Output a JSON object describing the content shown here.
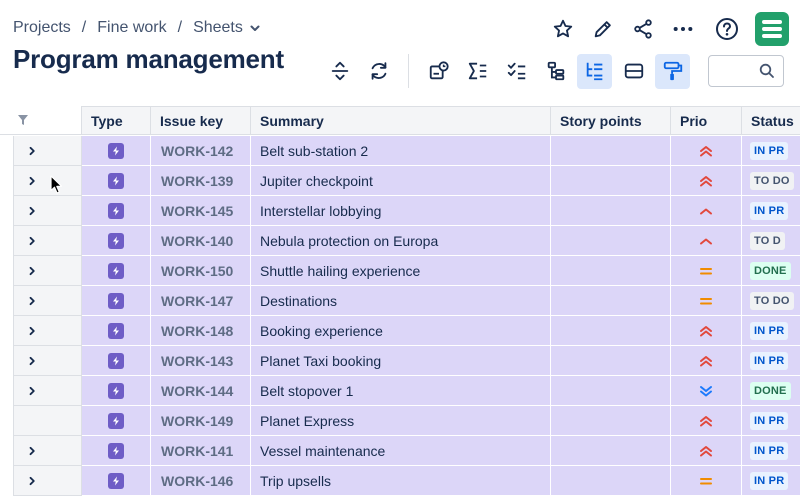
{
  "breadcrumb": {
    "items": [
      "Projects",
      "Fine work",
      "Sheets"
    ],
    "separator": "/"
  },
  "page": {
    "title": "Program management"
  },
  "search": {
    "placeholder": "",
    "value": ""
  },
  "columns": [
    "Type",
    "Issue key",
    "Summary",
    "Story points",
    "Prio",
    "Status"
  ],
  "colors": {
    "accent": "#0c66e4",
    "row_highlight": "#dcd6f8",
    "story_icon": "#6e5dc6",
    "logo": "#22a06b",
    "prio_high": "#e2483d",
    "prio_medium": "#f08c00",
    "prio_lowest": "#1d7afc"
  },
  "rows": [
    {
      "key": "WORK-142",
      "summary": "Belt sub-station 2",
      "priority": "highest",
      "status": "IN PR",
      "status_type": "inprogress",
      "expandable": true
    },
    {
      "key": "WORK-139",
      "summary": "Jupiter checkpoint",
      "priority": "highest",
      "status": "TO DO",
      "status_type": "todo",
      "expandable": true
    },
    {
      "key": "WORK-145",
      "summary": "Interstellar lobbying",
      "priority": "high",
      "status": "IN PR",
      "status_type": "inprogress",
      "expandable": true
    },
    {
      "key": "WORK-140",
      "summary": "Nebula protection on Europa",
      "priority": "high",
      "status": "TO D",
      "status_type": "todo",
      "expandable": true
    },
    {
      "key": "WORK-150",
      "summary": "Shuttle hailing experience",
      "priority": "medium",
      "status": "DONE",
      "status_type": "done",
      "expandable": true
    },
    {
      "key": "WORK-147",
      "summary": "Destinations",
      "priority": "medium",
      "status": "TO DO",
      "status_type": "todo",
      "expandable": true
    },
    {
      "key": "WORK-148",
      "summary": "Booking experience",
      "priority": "highest",
      "status": "IN PR",
      "status_type": "inprogress",
      "expandable": true
    },
    {
      "key": "WORK-143",
      "summary": "Planet Taxi booking",
      "priority": "highest",
      "status": "IN PR",
      "status_type": "inprogress",
      "expandable": true
    },
    {
      "key": "WORK-144",
      "summary": "Belt stopover 1",
      "priority": "lowest",
      "status": "DONE",
      "status_type": "done",
      "expandable": true
    },
    {
      "key": "WORK-149",
      "summary": "Planet Express",
      "priority": "highest",
      "status": "IN PR",
      "status_type": "inprogress",
      "expandable": false
    },
    {
      "key": "WORK-141",
      "summary": "Vessel maintenance",
      "priority": "highest",
      "status": "IN PR",
      "status_type": "inprogress",
      "expandable": true
    },
    {
      "key": "WORK-146",
      "summary": "Trip upsells",
      "priority": "medium",
      "status": "IN PR",
      "status_type": "inprogress",
      "expandable": true
    }
  ]
}
